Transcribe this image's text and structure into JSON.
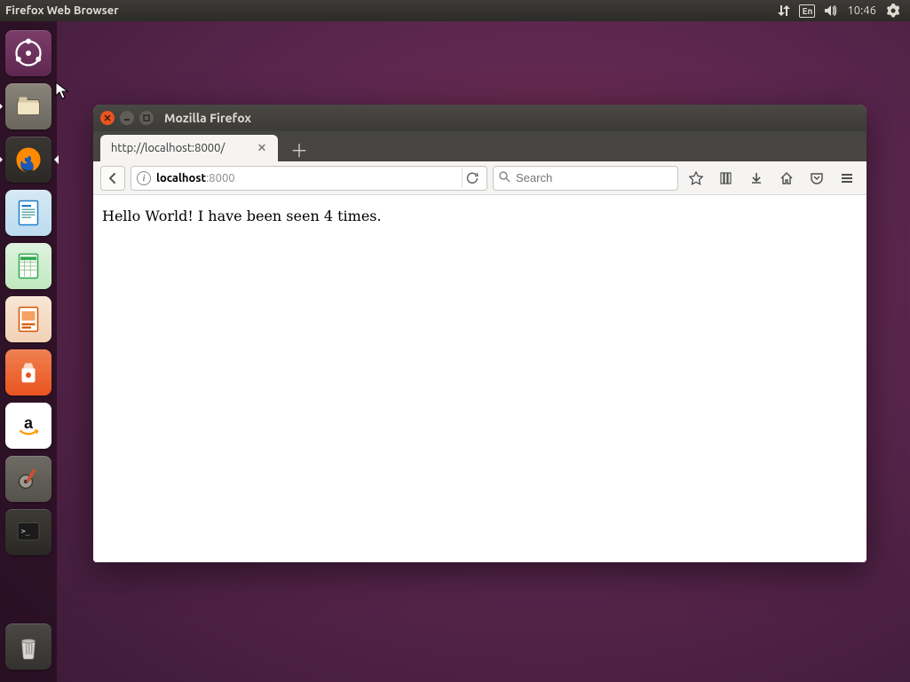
{
  "menubar": {
    "app_title": "Firefox Web Browser",
    "language": "En",
    "clock": "10:46"
  },
  "launcher": {
    "items": [
      {
        "name": "dash-icon",
        "bg": "#5e2750"
      },
      {
        "name": "files-icon",
        "bg": "#6e6b64"
      },
      {
        "name": "firefox-icon",
        "bg": "#2b2b2b"
      },
      {
        "name": "writer-icon",
        "bg": "#1e7fc9"
      },
      {
        "name": "calc-icon",
        "bg": "#2fa84f"
      },
      {
        "name": "impress-icon",
        "bg": "#d45500"
      },
      {
        "name": "software-icon",
        "bg": "#e95420"
      },
      {
        "name": "amazon-icon",
        "bg": "#ffffff"
      },
      {
        "name": "settings-icon",
        "bg": "#5c5b57"
      },
      {
        "name": "terminal-icon",
        "bg": "#2c2c2c"
      }
    ],
    "trash": {
      "name": "trash-icon"
    }
  },
  "window": {
    "title": "Mozilla Firefox",
    "tab": {
      "title": "http://localhost:8000/"
    },
    "urlbar": {
      "host": "localhost",
      "port": ":8000"
    },
    "searchbar": {
      "placeholder": "Search"
    },
    "page": {
      "body_text": "Hello World! I have been seen 4 times."
    }
  }
}
